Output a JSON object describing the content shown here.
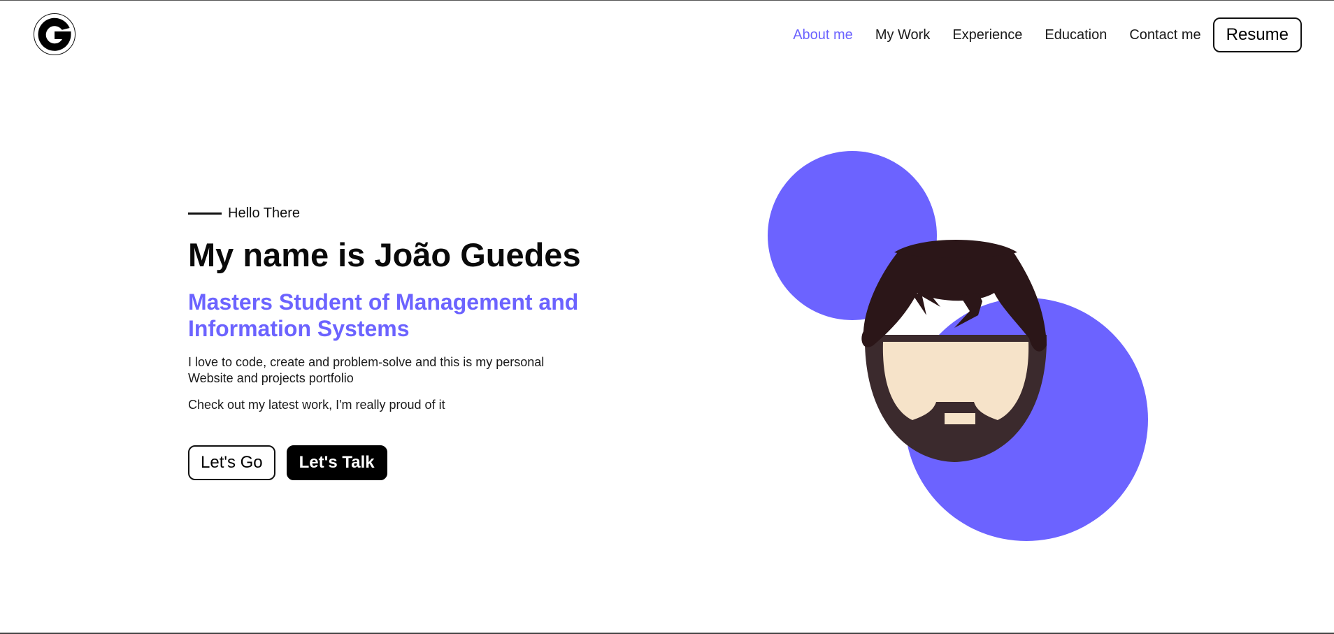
{
  "header": {
    "logo_icon": "g-letter-logo-icon",
    "nav": [
      {
        "label": "About me",
        "active": true
      },
      {
        "label": "My Work",
        "active": false
      },
      {
        "label": "Experience",
        "active": false
      },
      {
        "label": "Education",
        "active": false
      },
      {
        "label": "Contact me",
        "active": false
      }
    ],
    "resume_label": "Resume"
  },
  "hero": {
    "greeting": "Hello There",
    "headline": "My name is João Guedes",
    "subtitle": "Masters Student of Management and Information Systems",
    "description": "I love to code, create and problem-solve and this is my personal Website and projects portfolio",
    "description_secondary": "Check out my latest work, I'm really proud of it",
    "primary_button": "Let's Go",
    "secondary_button": "Let's Talk"
  },
  "illustration": {
    "icon": "bearded-man-avatar-icon"
  },
  "colors": {
    "accent": "#6c63ff",
    "text": "#111111",
    "hair": "#2b1618",
    "beard": "#3b2a2d",
    "skin": "#f6e3c9"
  }
}
